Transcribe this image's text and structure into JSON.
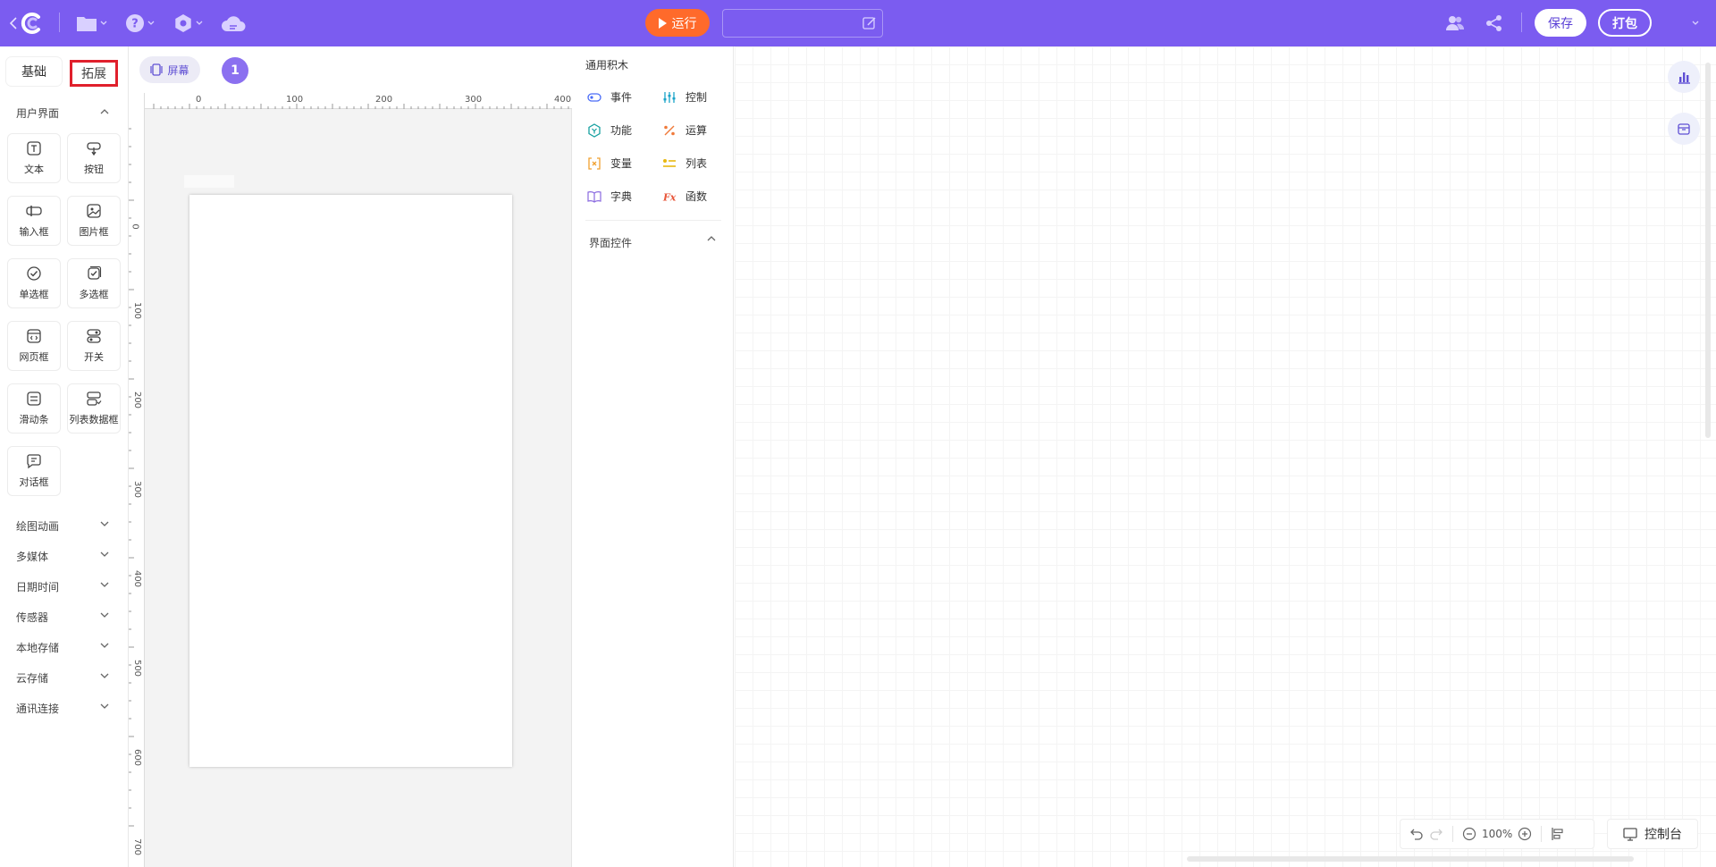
{
  "topbar": {
    "run_label": "运行",
    "project_name": "",
    "save_label": "保存",
    "pack_label": "打包"
  },
  "left_panel": {
    "tabs": [
      {
        "label": "基础",
        "active": true
      },
      {
        "label": "拓展",
        "active": false
      }
    ],
    "sections": [
      {
        "label": "用户界面",
        "expanded": true
      },
      {
        "label": "绘图动画"
      },
      {
        "label": "多媒体"
      },
      {
        "label": "日期时间"
      },
      {
        "label": "传感器"
      },
      {
        "label": "本地存储"
      },
      {
        "label": "云存储"
      },
      {
        "label": "通讯连接"
      }
    ],
    "components": [
      {
        "label": "文本",
        "icon": "text-icon"
      },
      {
        "label": "按钮",
        "icon": "button-icon"
      },
      {
        "label": "输入框",
        "icon": "input-icon"
      },
      {
        "label": "图片框",
        "icon": "image-icon"
      },
      {
        "label": "单选框",
        "icon": "radio-icon"
      },
      {
        "label": "多选框",
        "icon": "checkbox-icon"
      },
      {
        "label": "网页框",
        "icon": "webview-icon"
      },
      {
        "label": "开关",
        "icon": "switch-icon"
      },
      {
        "label": "滑动条",
        "icon": "slider-icon"
      },
      {
        "label": "列表数据框",
        "icon": "listdata-icon"
      },
      {
        "label": "对话框",
        "icon": "dialog-icon"
      }
    ]
  },
  "stage": {
    "screen_label": "屏幕",
    "screen_number": "1",
    "ruler_h": [
      "0",
      "100",
      "200",
      "300",
      "400"
    ],
    "ruler_v": [
      "0",
      "100",
      "200",
      "300",
      "400",
      "500",
      "600",
      "700"
    ]
  },
  "blocks": {
    "title": "通用积木",
    "items": [
      {
        "label": "事件",
        "color": "#4a6cf7"
      },
      {
        "label": "控制",
        "color": "#1aa3c8"
      },
      {
        "label": "功能",
        "color": "#16a0a0"
      },
      {
        "label": "运算",
        "color": "#f07a3a"
      },
      {
        "label": "变量",
        "color": "#f0a030"
      },
      {
        "label": "列表",
        "color": "#e8b810"
      },
      {
        "label": "字典",
        "color": "#8a6ae0"
      },
      {
        "label": "函数",
        "color": "#e8563a"
      }
    ],
    "ui_controls_label": "界面控件"
  },
  "workspace": {
    "zoom": "100%",
    "console_label": "控制台"
  },
  "colors": {
    "topbar": "#7b5cf0",
    "run": "#ff6a2b",
    "highlight": "#e0202c"
  }
}
